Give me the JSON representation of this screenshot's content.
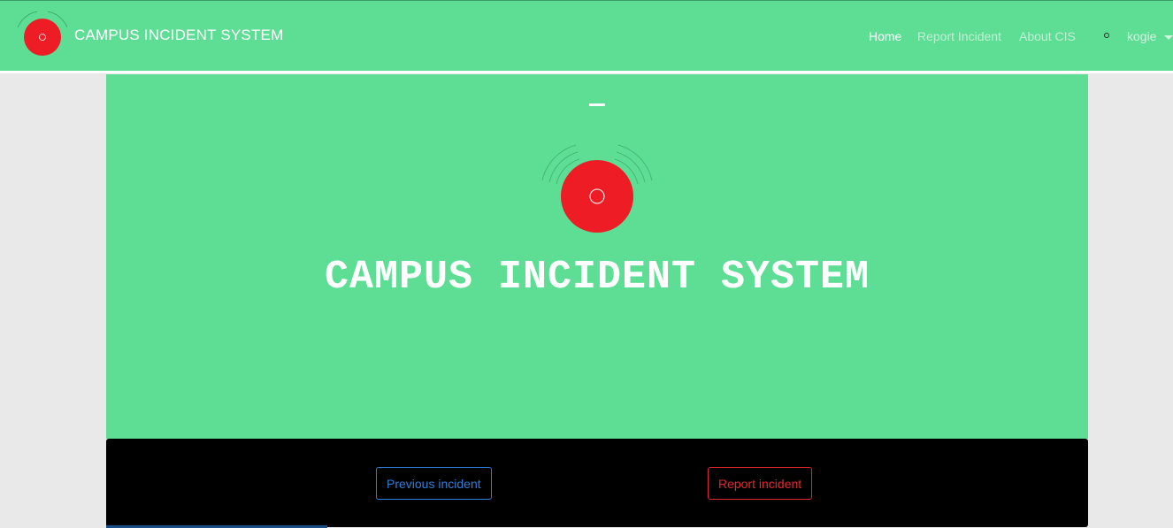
{
  "navbar": {
    "brand_title": "CAMPUS INCIDENT SYSTEM",
    "brand_icon": "alarm-icon",
    "links": [
      {
        "label": "Home",
        "active": true
      },
      {
        "label": "Report Incident",
        "active": false
      },
      {
        "label": "About CIS",
        "active": false
      }
    ],
    "user": {
      "name": "kogie",
      "icon": "user-status-icon"
    }
  },
  "hero": {
    "title": "CAMPUS INCIDENT SYSTEM",
    "logo_icon": "alarm-icon"
  },
  "actions": {
    "previous_label": "Previous incident",
    "report_label": "Report incident"
  },
  "colors": {
    "primary_green": "#5edd94",
    "alarm_red": "#ee1c25",
    "outline_blue": "#2d7fd8",
    "outline_red": "#e5262d",
    "action_bar": "#000000"
  }
}
